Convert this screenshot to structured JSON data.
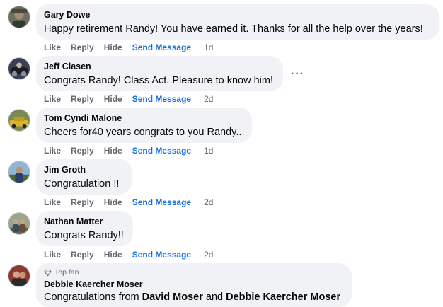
{
  "actions": {
    "like": "Like",
    "reply": "Reply",
    "hide": "Hide",
    "send_message": "Send Message"
  },
  "comments": [
    {
      "name": "Gary Dowe",
      "text": "Happy retirement Randy! You have earned it. Thanks for all the help over the years!",
      "time": "1d"
    },
    {
      "name": "Jeff Clasen",
      "text": "Congrats Randy! Class Act. Pleasure to know him!",
      "time": "2d",
      "more": "···"
    },
    {
      "name": "Tom Cyndi Malone",
      "text": "Cheers for40 years congrats to you Randy..",
      "time": "1d"
    },
    {
      "name": "Jim Groth",
      "text": "Congratulation !!",
      "time": "2d"
    },
    {
      "name": "Nathan Matter",
      "text": "Congrats Randy!!",
      "time": "2d"
    },
    {
      "badge": "Top fan",
      "name": "Debbie Kaercher Moser",
      "text_parts": [
        "Congratulations from ",
        "David Moser",
        " and ",
        "Debbie Kaercher Moser"
      ]
    }
  ],
  "colors": {
    "bubble": "#f0f2f5",
    "action_text": "#65676b",
    "link_blue": "#1a6ed8"
  }
}
